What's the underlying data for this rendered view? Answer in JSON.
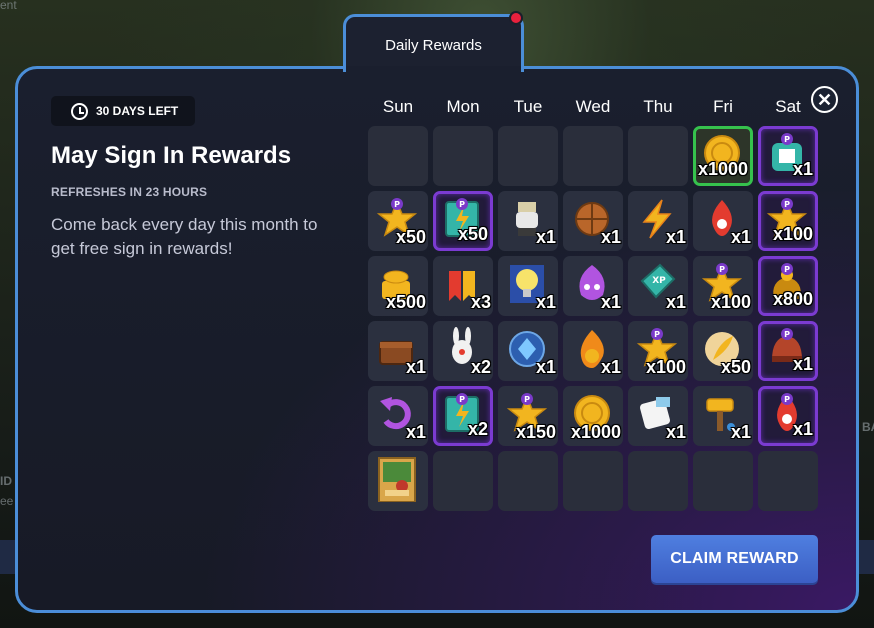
{
  "background_text": {
    "top_left": "ent",
    "left_mid": "ID",
    "left_sub": "ee",
    "right": "BA"
  },
  "tab": {
    "label": "Daily Rewards",
    "has_notification": true
  },
  "header": {
    "days_left": "30 DAYS LEFT",
    "title": "May Sign In Rewards",
    "refresh": "REFRESHES IN 23 HOURS",
    "description": "Come back every day this month to get free sign in rewards!"
  },
  "calendar": {
    "days": [
      "Sun",
      "Mon",
      "Tue",
      "Wed",
      "Thu",
      "Fri",
      "Sat"
    ],
    "rows": [
      [
        {
          "empty": true
        },
        {
          "empty": true
        },
        {
          "empty": true
        },
        {
          "empty": true
        },
        {
          "empty": true
        },
        {
          "icon": "gold-coin-stack-icon",
          "qty": "x1000",
          "style": "today"
        },
        {
          "icon": "premium-puzzle-icon",
          "qty": "x1",
          "style": "premium"
        }
      ],
      [
        {
          "icon": "star-points-icon",
          "qty": "x50",
          "style": "normal"
        },
        {
          "icon": "premium-card-icon",
          "qty": "x50",
          "style": "premium"
        },
        {
          "icon": "character-figure-icon",
          "qty": "x1",
          "style": "normal"
        },
        {
          "icon": "basket-ball-icon",
          "qty": "x1",
          "style": "normal"
        },
        {
          "icon": "lightning-bolt-icon",
          "qty": "x1",
          "style": "normal"
        },
        {
          "icon": "fire-pin-icon",
          "qty": "x1",
          "style": "normal"
        },
        {
          "icon": "premium-star-icon",
          "qty": "x100",
          "style": "premium"
        }
      ],
      [
        {
          "icon": "gold-coins-icon",
          "qty": "x500",
          "style": "normal"
        },
        {
          "icon": "ribbon-badge-icon",
          "qty": "x3",
          "style": "normal"
        },
        {
          "icon": "lightbulb-card-icon",
          "qty": "x1",
          "style": "normal"
        },
        {
          "icon": "purple-flame-mask-icon",
          "qty": "x1",
          "style": "normal"
        },
        {
          "icon": "xp-ticket-icon",
          "qty": "x1",
          "style": "normal"
        },
        {
          "icon": "star-points-icon",
          "qty": "x100",
          "style": "normal"
        },
        {
          "icon": "premium-coin-bag-icon",
          "qty": "x800",
          "style": "premium"
        }
      ],
      [
        {
          "icon": "treasure-box-icon",
          "qty": "x1",
          "style": "normal"
        },
        {
          "icon": "bunny-figure-icon",
          "qty": "x2",
          "style": "normal"
        },
        {
          "icon": "blue-orb-icon",
          "qty": "x1",
          "style": "normal"
        },
        {
          "icon": "fire-coin-icon",
          "qty": "x1",
          "style": "normal"
        },
        {
          "icon": "star-points-icon",
          "qty": "x100",
          "style": "normal"
        },
        {
          "icon": "gold-feather-icon",
          "qty": "x50",
          "style": "normal"
        },
        {
          "icon": "premium-helmet-icon",
          "qty": "x1",
          "style": "premium"
        }
      ],
      [
        {
          "icon": "undo-arrow-icon",
          "qty": "x1",
          "style": "normal"
        },
        {
          "icon": "premium-card-icon",
          "qty": "x2",
          "style": "premium"
        },
        {
          "icon": "star-points-icon",
          "qty": "x150",
          "style": "normal"
        },
        {
          "icon": "gold-coin-stack-icon",
          "qty": "x1000",
          "style": "normal"
        },
        {
          "icon": "puzzle-ticket-icon",
          "qty": "x1",
          "style": "normal"
        },
        {
          "icon": "gold-hammer-icon",
          "qty": "x1",
          "style": "normal"
        },
        {
          "icon": "premium-fire-pin-icon",
          "qty": "x1",
          "style": "premium"
        }
      ],
      [
        {
          "icon": "character-card-icon",
          "qty": "",
          "style": "normal"
        },
        {
          "empty": true
        },
        {
          "empty": true
        },
        {
          "empty": true
        },
        {
          "empty": true
        },
        {
          "empty": true
        },
        {
          "empty": true
        }
      ]
    ]
  },
  "claim_button": {
    "label": "CLAIM REWARD"
  },
  "close_button": {
    "label": "✕"
  },
  "colors": {
    "accent_border": "#4b8ed8",
    "premium_border": "#7b3bd1",
    "today_border": "#36c24d",
    "claim_button": "#4a72d8",
    "notification": "#e8213d"
  }
}
